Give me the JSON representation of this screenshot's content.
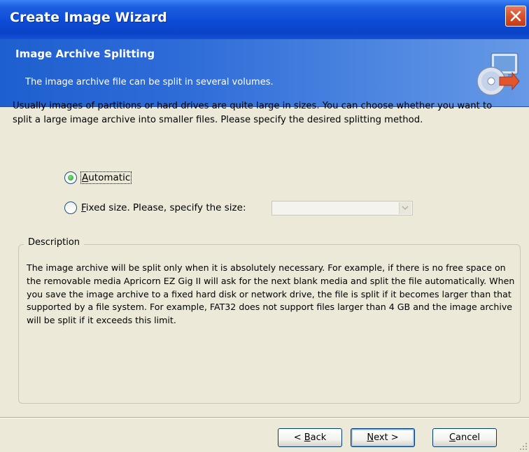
{
  "window": {
    "title": "Create Image Wizard"
  },
  "header": {
    "title": "Image Archive Splitting",
    "subtitle": "The image archive file can be split in several volumes.",
    "icon": "image-archive-icon"
  },
  "intro": "Usually images of partitions or hard drives are quite large in sizes. You can choose whether you want to split a large image archive into smaller files. Please specify the desired splitting method.",
  "options": {
    "automatic": {
      "label_underline": "A",
      "label_rest": "utomatic",
      "checked": true
    },
    "fixed": {
      "label_underline": "F",
      "label_rest": "ixed size. Please, specify the size:",
      "checked": false,
      "size_value": ""
    }
  },
  "description": {
    "legend": "Description",
    "text": "The image archive will be split only when it is absolutely necessary. For example, if there is no free space on the removable media Apricorn EZ Gig II will ask for the next blank media and split the file automatically. When you save the image archive to a fixed hard disk or network drive, the file is split if it becomes larger than that supported by a file system. For example, FAT32 does not support files larger than 4 GB and the image archive will be split if it exceeds this limit."
  },
  "buttons": {
    "back_prefix": "< ",
    "back_underline": "B",
    "back_rest": "ack",
    "next_underline": "N",
    "next_rest": "ext >",
    "cancel_underline": "C",
    "cancel_rest": "ancel"
  },
  "colors": {
    "title_bar": "#0A43C6",
    "header_bg": "#2E6CD8",
    "close_button": "#D9502C",
    "dialog_bg": "#ECE9D8",
    "radio_checked": "#1FA11F"
  }
}
